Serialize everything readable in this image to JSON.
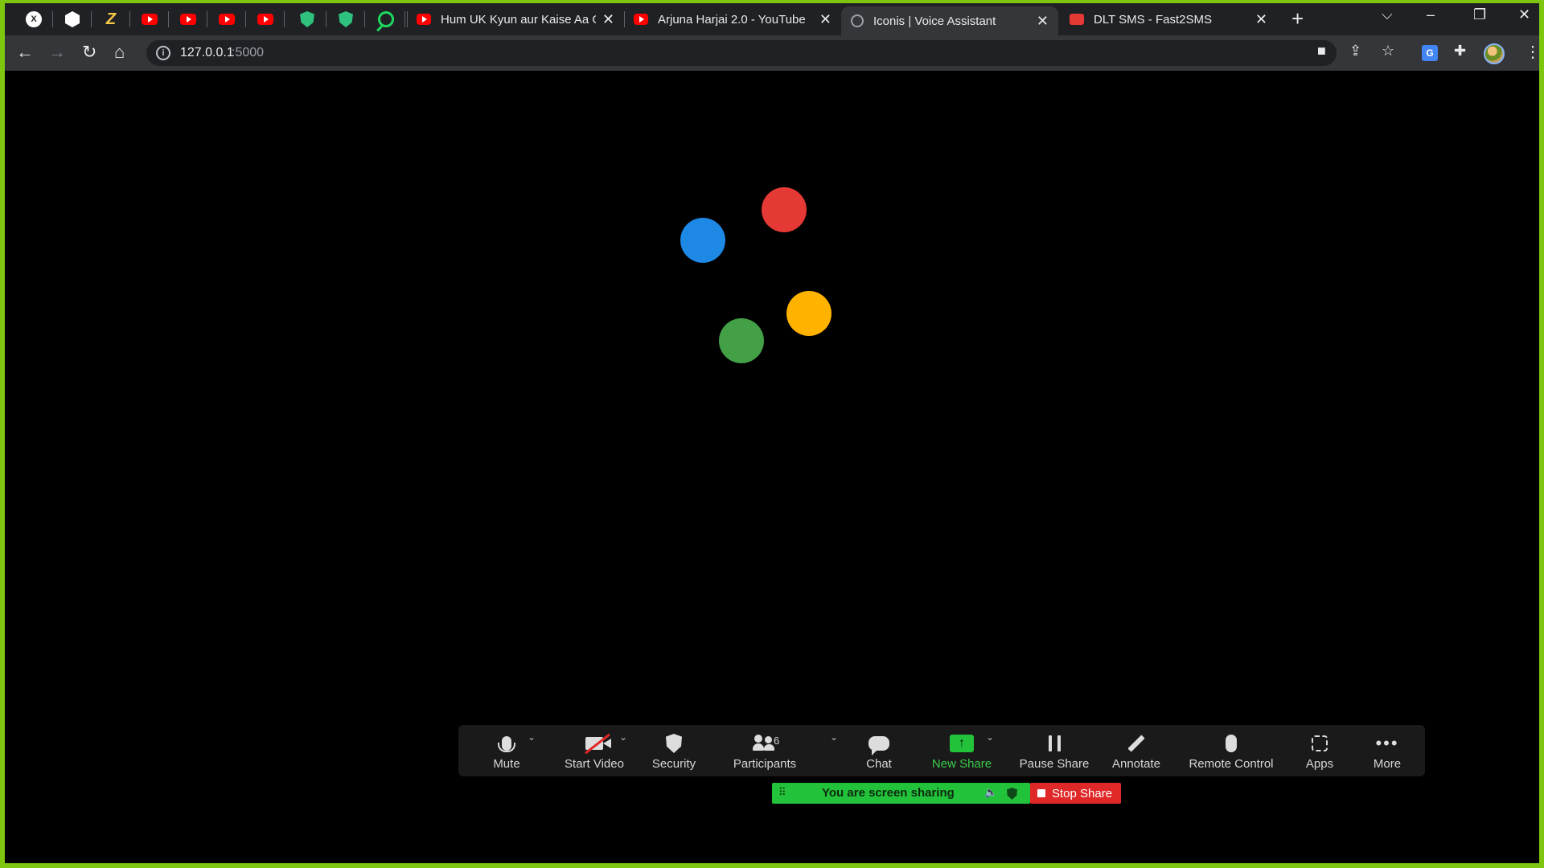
{
  "browser": {
    "pinned_tabs": [
      {
        "icon": "x-logo-icon",
        "glyph": "X"
      },
      {
        "icon": "hexagon-logo-icon"
      },
      {
        "icon": "lightning-logo-icon",
        "glyph": "Z"
      },
      {
        "icon": "youtube-icon"
      },
      {
        "icon": "youtube-icon"
      },
      {
        "icon": "youtube-icon"
      },
      {
        "icon": "youtube-icon"
      },
      {
        "icon": "green-shield-icon"
      },
      {
        "icon": "green-shield-icon"
      },
      {
        "icon": "green-search-icon"
      }
    ],
    "tabs": [
      {
        "title": "Hum UK Kyun aur Kaise Aa Gaye",
        "icon": "youtube-icon",
        "active": false
      },
      {
        "title": "Arjuna Harjai 2.0 - YouTube",
        "icon": "youtube-icon",
        "active": false
      },
      {
        "title": "Iconis | Voice Assistant",
        "icon": "globe-icon",
        "active": true
      },
      {
        "title": "DLT SMS - Fast2SMS",
        "icon": "fast2sms-icon",
        "active": false
      }
    ],
    "close_glyph": "✕",
    "new_tab_glyph": "+",
    "window_controls": {
      "dropdown": "⌵",
      "minimize": "–",
      "restore": "❐",
      "close": "✕"
    },
    "nav": {
      "back": "←",
      "forward": "→",
      "reload": "↻",
      "home": "⌂"
    },
    "address": {
      "host": "127.0.0.1",
      "port": ":5000",
      "info_glyph": "i"
    },
    "toolbar_icons": {
      "camera": "■",
      "share": "⇪",
      "bookmark": "☆",
      "translate": "G",
      "extensions": "✚",
      "menu": "⋮"
    }
  },
  "page": {
    "dots": [
      {
        "name": "blue",
        "color": "#1e88e5"
      },
      {
        "name": "red",
        "color": "#e53935"
      },
      {
        "name": "yellow",
        "color": "#ffb300"
      },
      {
        "name": "green",
        "color": "#43a047"
      }
    ]
  },
  "zoom": {
    "controls": {
      "mute": "Mute",
      "start_video": "Start Video",
      "security": "Security",
      "participants": "Participants",
      "participants_count": "6",
      "chat": "Chat",
      "new_share": "New Share",
      "pause_share": "Pause Share",
      "annotate": "Annotate",
      "remote_control": "Remote Control",
      "apps": "Apps",
      "more": "More"
    },
    "caret_glyph": "⌄",
    "more_glyph": "•••",
    "share_arrow": "↑",
    "sharing_banner": {
      "text": "You are screen sharing",
      "handle": "⠿",
      "speaker": "🔈"
    },
    "stop_share": "Stop Share",
    "colors": {
      "accent_green": "#22c33b",
      "stop_red": "#e02828",
      "frame_green": "#7dc50e"
    }
  }
}
